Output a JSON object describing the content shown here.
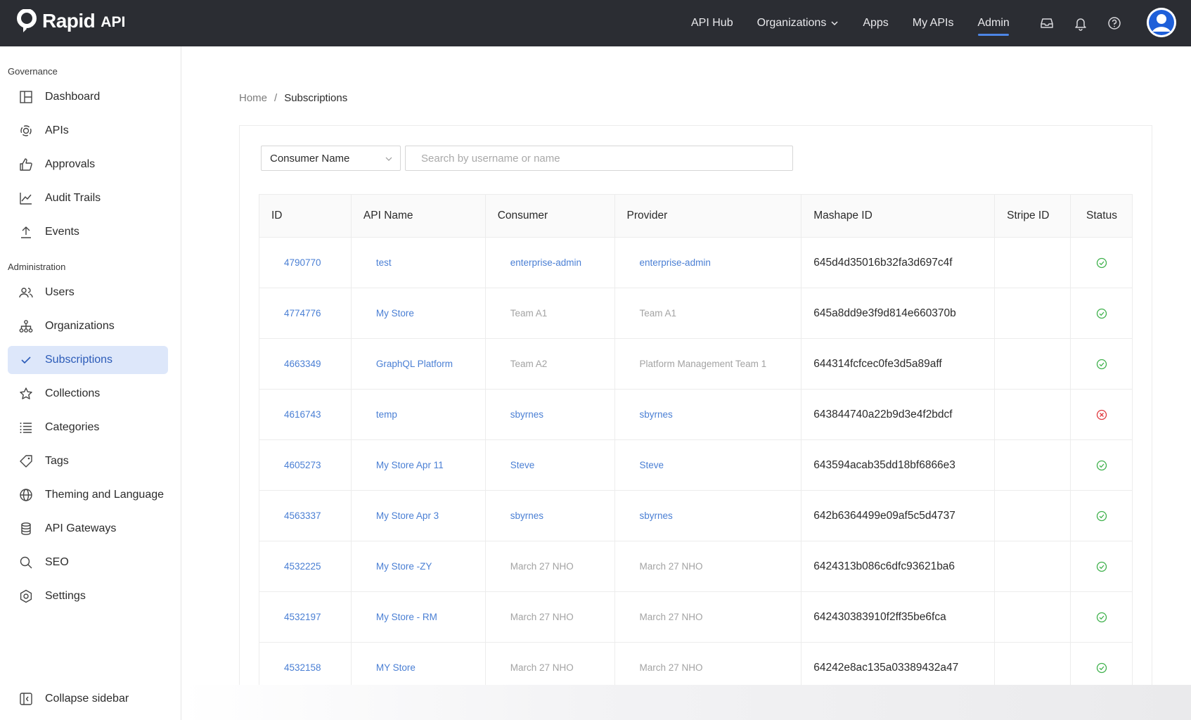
{
  "brand": {
    "name": "Rapid",
    "sub": "API"
  },
  "topnav": {
    "items": [
      {
        "label": "API Hub"
      },
      {
        "label": "Organizations"
      },
      {
        "label": "Apps"
      },
      {
        "label": "My APIs"
      },
      {
        "label": "Admin"
      }
    ],
    "active": "Admin"
  },
  "sidebar": {
    "governance_title": "Governance",
    "governance": [
      {
        "label": "Dashboard",
        "icon": "dashboard-icon"
      },
      {
        "label": "APIs",
        "icon": "apis-icon"
      },
      {
        "label": "Approvals",
        "icon": "thumbs-up-icon"
      },
      {
        "label": "Audit Trails",
        "icon": "chart-line-icon"
      },
      {
        "label": "Events",
        "icon": "upload-icon"
      }
    ],
    "administration_title": "Administration",
    "administration": [
      {
        "label": "Users",
        "icon": "users-icon"
      },
      {
        "label": "Organizations",
        "icon": "org-tree-icon"
      },
      {
        "label": "Subscriptions",
        "icon": "check-icon"
      },
      {
        "label": "Collections",
        "icon": "star-icon"
      },
      {
        "label": "Categories",
        "icon": "list-icon"
      },
      {
        "label": "Tags",
        "icon": "tag-icon"
      },
      {
        "label": "Theming and Language",
        "icon": "globe-icon"
      },
      {
        "label": "API Gateways",
        "icon": "database-icon"
      },
      {
        "label": "SEO",
        "icon": "search-icon"
      },
      {
        "label": "Settings",
        "icon": "gear-icon"
      }
    ],
    "collapse_label": "Collapse sidebar"
  },
  "breadcrumb": {
    "home": "Home",
    "separator": "/",
    "current": "Subscriptions"
  },
  "filter": {
    "selected": "Consumer Name",
    "search_placeholder": "Search by username or name"
  },
  "table": {
    "headers": [
      "ID",
      "API Name",
      "Consumer",
      "Provider",
      "Mashape ID",
      "Stripe ID",
      "Status"
    ],
    "rows": [
      {
        "id": "4790770",
        "api": "test",
        "consumer": "enterprise-admin",
        "consumer_link": true,
        "provider": "enterprise-admin",
        "provider_link": true,
        "mashape": "645d4d35016b32fa3d697c4f",
        "stripe": "",
        "status": "active"
      },
      {
        "id": "4774776",
        "api": "My Store",
        "consumer": "Team A1",
        "consumer_link": false,
        "provider": "Team A1",
        "provider_link": false,
        "mashape": "645a8dd9e3f9d814e660370b",
        "stripe": "",
        "status": "active"
      },
      {
        "id": "4663349",
        "api": "GraphQL Platform",
        "consumer": "Team A2",
        "consumer_link": false,
        "provider": "Platform Management Team 1",
        "provider_link": false,
        "mashape": "644314fcfcec0fe3d5a89aff",
        "stripe": "",
        "status": "active"
      },
      {
        "id": "4616743",
        "api": "temp",
        "consumer": "sbyrnes",
        "consumer_link": true,
        "provider": "sbyrnes",
        "provider_link": true,
        "mashape": "643844740a22b9d3e4f2bdcf",
        "stripe": "",
        "status": "inactive"
      },
      {
        "id": "4605273",
        "api": "My Store Apr 11",
        "consumer": "Steve",
        "consumer_link": true,
        "provider": "Steve",
        "provider_link": true,
        "mashape": "643594acab35dd18bf6866e3",
        "stripe": "",
        "status": "active"
      },
      {
        "id": "4563337",
        "api": "My Store Apr 3",
        "consumer": "sbyrnes",
        "consumer_link": true,
        "provider": "sbyrnes",
        "provider_link": true,
        "mashape": "642b6364499e09af5c5d4737",
        "stripe": "",
        "status": "active"
      },
      {
        "id": "4532225",
        "api": "My Store -ZY",
        "consumer": "March 27 NHO",
        "consumer_link": false,
        "provider": "March 27 NHO",
        "provider_link": false,
        "mashape": "6424313b086c6dfc93621ba6",
        "stripe": "",
        "status": "active"
      },
      {
        "id": "4532197",
        "api": "My Store - RM",
        "consumer": "March 27 NHO",
        "consumer_link": false,
        "provider": "March 27 NHO",
        "provider_link": false,
        "mashape": "642430383910f2ff35be6fca",
        "stripe": "",
        "status": "active"
      },
      {
        "id": "4532158",
        "api": "MY Store",
        "consumer": "March 27 NHO",
        "consumer_link": false,
        "provider": "March 27 NHO",
        "provider_link": false,
        "mashape": "64242e8ac135a03389432a47",
        "stripe": "",
        "status": "active"
      }
    ]
  },
  "colors": {
    "topbar": "#2b2d33",
    "accent": "#4a7fd4",
    "active_bg": "#dde7fa",
    "status_ok": "#3fb14c",
    "status_err": "#e0393e"
  }
}
